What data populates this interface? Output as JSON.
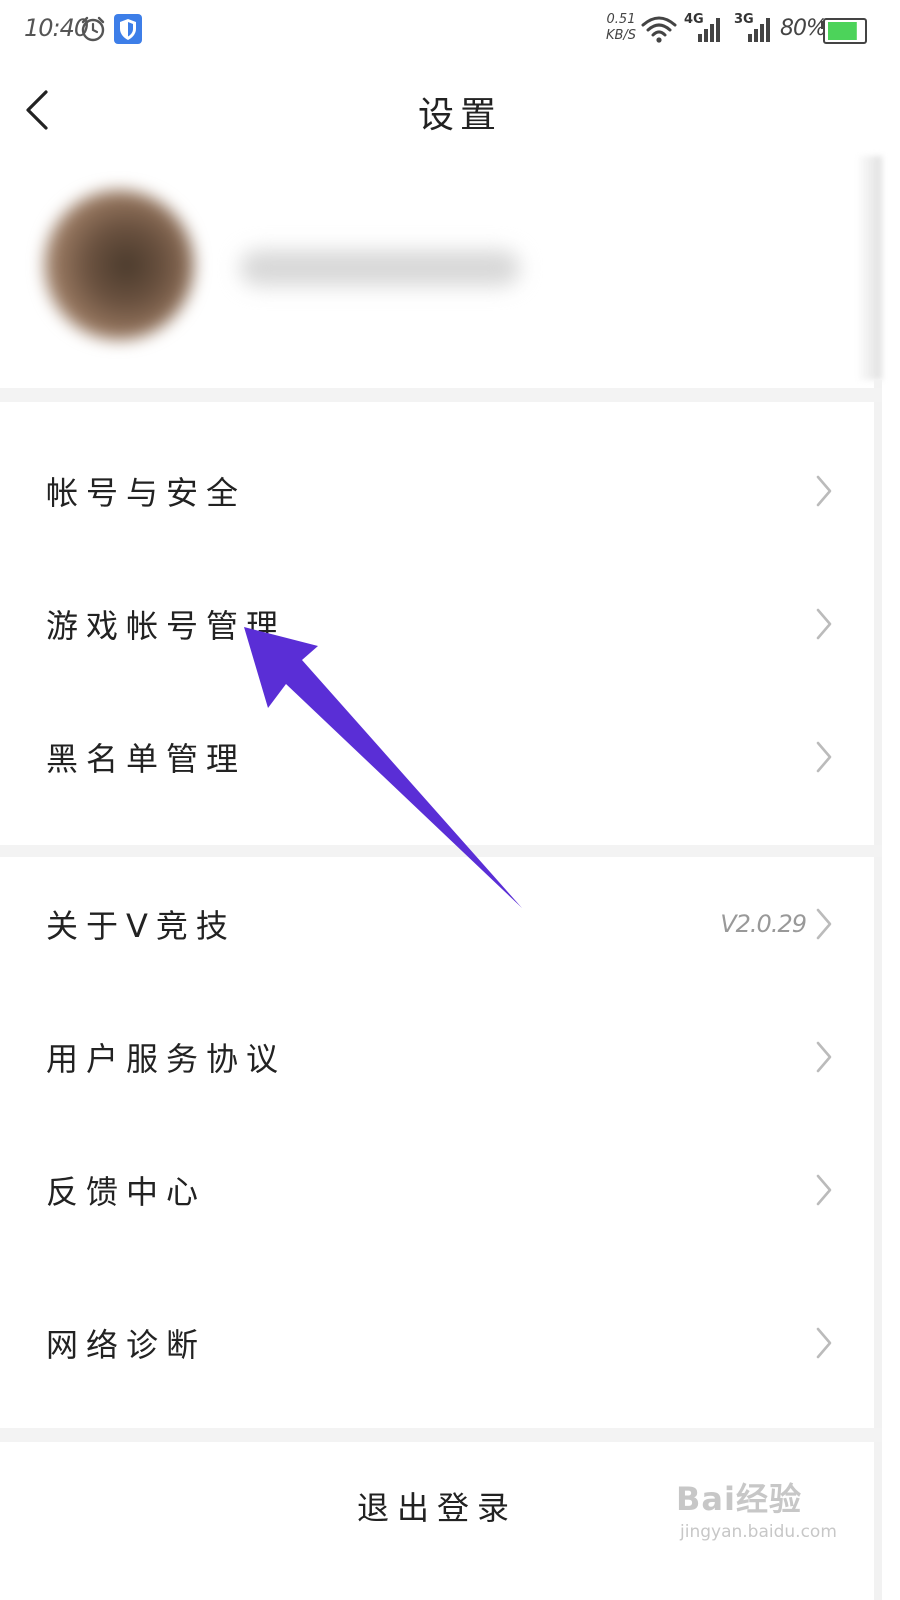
{
  "status_bar": {
    "time": "10:40",
    "net_speed_value": "0.51",
    "net_speed_unit": "KB/S",
    "network_1": "4G",
    "network_2": "3G",
    "battery_percent": "80%",
    "battery_level": 0.8,
    "icons": [
      "alarm-icon",
      "shield-icon",
      "wifi-icon",
      "signal-4g-icon",
      "signal-3g-icon",
      "battery-icon"
    ]
  },
  "header": {
    "title": "设置",
    "back_icon": "chevron-left-icon"
  },
  "settings": {
    "group1": [
      {
        "label": "帐号与安全"
      },
      {
        "label": "游戏帐号管理"
      },
      {
        "label": "黑名单管理"
      }
    ],
    "group2": [
      {
        "label": "关于V竞技",
        "value": "V2.0.29"
      },
      {
        "label": "用户服务协议"
      },
      {
        "label": "反馈中心"
      },
      {
        "label": "网络诊断"
      }
    ]
  },
  "logout_label": "退出登录",
  "annotation": {
    "arrow_color": "#5a2ed6"
  },
  "watermark": {
    "brand": "Bai经验",
    "url": "jingyan.baidu.com"
  }
}
